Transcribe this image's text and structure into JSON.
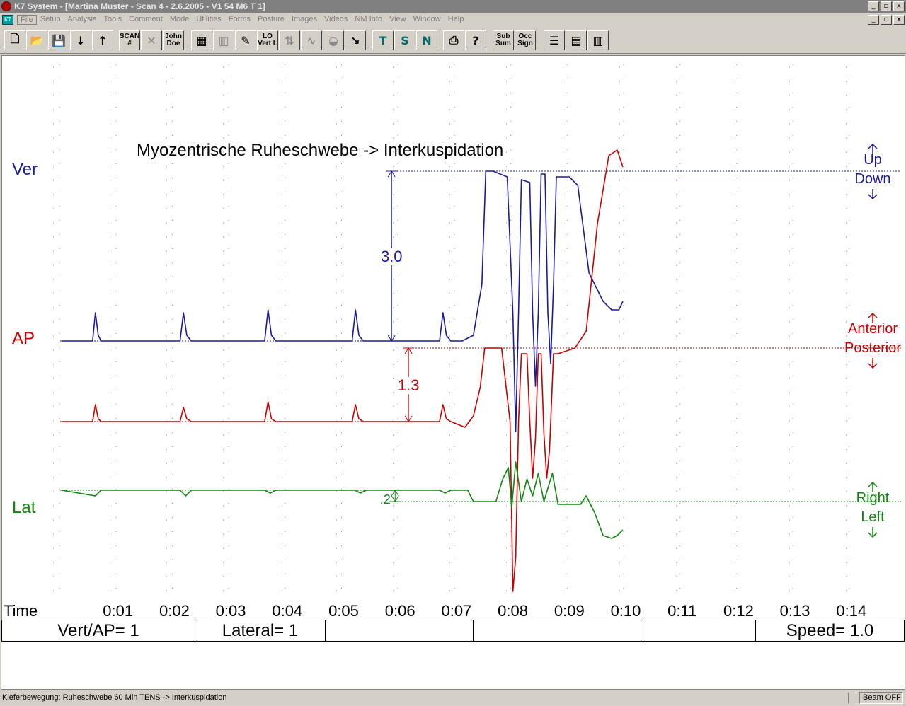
{
  "window": {
    "title": "K7 System - [Martina Muster - Scan 4 - 2.6.2005 - V1 54   M6  T 1]",
    "controls": [
      "_",
      "▫",
      "x"
    ],
    "doc_controls": [
      "_",
      "▫",
      "x"
    ]
  },
  "menu": {
    "doc_icon": "K7",
    "items": [
      "File",
      "Setup",
      "Analysis",
      "Tools",
      "Comment",
      "Mode",
      "Utilities",
      "Forms",
      "Posture",
      "Images",
      "Videos",
      "NM Info",
      "View",
      "Window",
      "Help"
    ]
  },
  "toolbar": {
    "groups": [
      [
        {
          "icon": "new-file-icon",
          "glyph": "🗋",
          "style": "normal"
        },
        {
          "icon": "open-folder-icon",
          "glyph": "📂",
          "style": "normal"
        },
        {
          "icon": "save-icon",
          "glyph": "💾",
          "style": "grey"
        },
        {
          "icon": "arrow-down-icon",
          "glyph": "↓",
          "style": "normal"
        },
        {
          "icon": "arrow-up-icon",
          "glyph": "↑",
          "style": "normal"
        }
      ],
      [
        {
          "icon": "scan-number-icon",
          "text": [
            "SCAN",
            "#"
          ],
          "style": "normal"
        },
        {
          "icon": "tools-icon",
          "glyph": "✕",
          "style": "grey"
        },
        {
          "icon": "john-doe-icon",
          "text": [
            "John",
            "Doe"
          ],
          "style": "normal"
        }
      ],
      [
        {
          "icon": "sweep-icon",
          "glyph": "▦",
          "style": "normal"
        },
        {
          "icon": "bars-icon",
          "glyph": "▥",
          "style": "grey"
        },
        {
          "icon": "pencil-icon",
          "glyph": "✎",
          "style": "normal"
        },
        {
          "icon": "vert-lat-icon",
          "text": [
            "LO",
            "Vert L"
          ],
          "style": "normal"
        },
        {
          "icon": "lat-icon",
          "glyph": "⇅",
          "style": "grey"
        },
        {
          "icon": "wave-icon",
          "glyph": "∿",
          "style": "grey"
        },
        {
          "icon": "head-icon",
          "glyph": "◒",
          "style": "grey"
        },
        {
          "icon": "cursor-icon",
          "glyph": "↘",
          "style": "normal"
        }
      ],
      [
        {
          "icon": "template-t-icon",
          "glyph": "T",
          "style": "teal"
        },
        {
          "icon": "template-s-icon",
          "glyph": "S",
          "style": "teal"
        },
        {
          "icon": "template-n-icon",
          "glyph": "N",
          "style": "teal"
        }
      ],
      [
        {
          "icon": "printer-icon",
          "glyph": "⎙",
          "style": "normal"
        },
        {
          "icon": "help-icon",
          "glyph": "?",
          "style": "normal"
        }
      ],
      [
        {
          "icon": "sub-sum-icon",
          "text": [
            "Sub",
            "Sum"
          ],
          "style": "normal"
        },
        {
          "icon": "occ-sign-icon",
          "text": [
            "Occ",
            "Sign"
          ],
          "style": "normal"
        }
      ],
      [
        {
          "icon": "layout-stack-icon",
          "glyph": "☰",
          "style": "normal"
        },
        {
          "icon": "layout-rows-icon",
          "glyph": "▤",
          "style": "normal"
        },
        {
          "icon": "layout-cols-icon",
          "glyph": "▥",
          "style": "normal"
        }
      ]
    ]
  },
  "chart_data": {
    "type": "line",
    "title": "Myozentrische Ruheschwebe -> Interkuspidation",
    "xlabel": "Time",
    "x_ticks": [
      "0:01",
      "0:02",
      "0:03",
      "0:04",
      "0:05",
      "0:06",
      "0:07",
      "0:08",
      "0:09",
      "0:10",
      "0:11",
      "0:12",
      "0:13",
      "0:14"
    ],
    "xlim": [
      0,
      14.5
    ],
    "grid": "dotted",
    "colors": {
      "ver": "#1a1aa0",
      "ap": "#cc0000",
      "lat": "#118811"
    },
    "series": [
      {
        "name": "Ver",
        "key": "ver",
        "unit_note": "trace value, 0 = baseline, positive = up",
        "points": [
          [
            0,
            0
          ],
          [
            0.55,
            0
          ],
          [
            0.6,
            0.5
          ],
          [
            0.65,
            0.1
          ],
          [
            0.7,
            0
          ],
          [
            1.1,
            0
          ],
          [
            2.1,
            0
          ],
          [
            2.16,
            0.5
          ],
          [
            2.22,
            0.1
          ],
          [
            2.3,
            0
          ],
          [
            3.6,
            0
          ],
          [
            3.66,
            0.55
          ],
          [
            3.72,
            0.1
          ],
          [
            3.8,
            0
          ],
          [
            5.15,
            0
          ],
          [
            5.21,
            0.55
          ],
          [
            5.27,
            0.1
          ],
          [
            5.35,
            0
          ],
          [
            6.7,
            0
          ],
          [
            6.76,
            0.5
          ],
          [
            6.82,
            0.1
          ],
          [
            6.9,
            0
          ],
          [
            7.1,
            0
          ],
          [
            7.3,
            0.1
          ],
          [
            7.45,
            1.0
          ],
          [
            7.52,
            3.0
          ],
          [
            7.65,
            3.0
          ],
          [
            7.9,
            2.9
          ],
          [
            8.0,
            0.5
          ],
          [
            8.05,
            -1.6
          ],
          [
            8.1,
            0.5
          ],
          [
            8.15,
            2.85
          ],
          [
            8.3,
            2.8
          ],
          [
            8.35,
            0.5
          ],
          [
            8.4,
            -0.8
          ],
          [
            8.45,
            0.5
          ],
          [
            8.5,
            2.95
          ],
          [
            8.57,
            2.95
          ],
          [
            8.62,
            0.5
          ],
          [
            8.67,
            -0.4
          ],
          [
            8.72,
            1.0
          ],
          [
            8.77,
            2.9
          ],
          [
            9.0,
            2.9
          ],
          [
            9.15,
            2.75
          ],
          [
            9.35,
            1.2
          ],
          [
            9.6,
            0.7
          ],
          [
            9.75,
            0.55
          ],
          [
            9.88,
            0.55
          ],
          [
            9.95,
            0.7
          ]
        ]
      },
      {
        "name": "AP",
        "key": "ap",
        "unit_note": "trace value, 0 = baseline, positive = anterior",
        "points": [
          [
            0,
            0
          ],
          [
            0.55,
            0
          ],
          [
            0.6,
            0.3
          ],
          [
            0.65,
            0.05
          ],
          [
            0.7,
            0
          ],
          [
            2.1,
            0
          ],
          [
            2.16,
            0.25
          ],
          [
            2.22,
            0.05
          ],
          [
            2.3,
            0
          ],
          [
            3.6,
            0
          ],
          [
            3.66,
            0.35
          ],
          [
            3.72,
            0.05
          ],
          [
            3.8,
            0
          ],
          [
            5.15,
            0
          ],
          [
            5.21,
            0.3
          ],
          [
            5.27,
            0.05
          ],
          [
            5.35,
            0
          ],
          [
            6.7,
            0
          ],
          [
            6.76,
            0.3
          ],
          [
            6.82,
            0.05
          ],
          [
            6.9,
            0
          ],
          [
            7.15,
            -0.1
          ],
          [
            7.3,
            0.1
          ],
          [
            7.42,
            0.6
          ],
          [
            7.5,
            1.3
          ],
          [
            7.8,
            1.3
          ],
          [
            7.95,
            0
          ],
          [
            8.0,
            -3.0
          ],
          [
            8.05,
            -2.4
          ],
          [
            8.1,
            0
          ],
          [
            8.15,
            1.2
          ],
          [
            8.25,
            1.2
          ],
          [
            8.3,
            0
          ],
          [
            8.35,
            -1.0
          ],
          [
            8.4,
            -0.3
          ],
          [
            8.45,
            1.2
          ],
          [
            8.5,
            1.2
          ],
          [
            8.55,
            -0.2
          ],
          [
            8.6,
            -1.0
          ],
          [
            8.65,
            -0.5
          ],
          [
            8.72,
            1.2
          ],
          [
            8.8,
            1.2
          ],
          [
            9.1,
            1.3
          ],
          [
            9.3,
            1.6
          ],
          [
            9.5,
            3.5
          ],
          [
            9.7,
            4.7
          ],
          [
            9.85,
            4.8
          ],
          [
            9.95,
            4.5
          ]
        ]
      },
      {
        "name": "Lat",
        "key": "lat",
        "unit_note": "trace value, 0 = baseline, positive = right",
        "points": [
          [
            0,
            0
          ],
          [
            0.6,
            -0.1
          ],
          [
            0.7,
            0
          ],
          [
            2.1,
            0
          ],
          [
            2.2,
            -0.1
          ],
          [
            2.3,
            0
          ],
          [
            3.6,
            0
          ],
          [
            3.7,
            -0.05
          ],
          [
            3.8,
            0
          ],
          [
            5.2,
            0
          ],
          [
            5.3,
            -0.05
          ],
          [
            5.4,
            0
          ],
          [
            6.7,
            0
          ],
          [
            6.8,
            -0.05
          ],
          [
            6.9,
            0
          ],
          [
            7.2,
            0
          ],
          [
            7.3,
            -0.2
          ],
          [
            7.5,
            -0.2
          ],
          [
            7.7,
            -0.2
          ],
          [
            7.82,
            0.2
          ],
          [
            7.92,
            0.4
          ],
          [
            7.98,
            -0.3
          ],
          [
            8.05,
            0.5
          ],
          [
            8.15,
            -0.2
          ],
          [
            8.25,
            0.2
          ],
          [
            8.35,
            -0.1
          ],
          [
            8.45,
            0.3
          ],
          [
            8.55,
            -0.2
          ],
          [
            8.7,
            0.3
          ],
          [
            8.8,
            -0.25
          ],
          [
            9.2,
            -0.25
          ],
          [
            9.3,
            -0.1
          ],
          [
            9.45,
            -0.4
          ],
          [
            9.6,
            -0.8
          ],
          [
            9.75,
            -0.85
          ],
          [
            9.85,
            -0.8
          ],
          [
            9.95,
            -0.7
          ]
        ]
      }
    ],
    "labels": {
      "ver": "Ver",
      "ap": "AP",
      "lat": "Lat"
    },
    "measurements": [
      {
        "label": "3.0",
        "series": "ver",
        "from": 0,
        "to": 3.0,
        "x": 5.85
      },
      {
        "label": "1.3",
        "series": "ap",
        "from": 0,
        "to": 1.3,
        "x": 6.15
      },
      {
        "label": ".2",
        "series": "lat",
        "from": 0,
        "to": -0.2,
        "x": 5.9
      }
    ],
    "direction_labels": {
      "ver": [
        "Up",
        "Down"
      ],
      "ap": [
        "Anterior",
        "Posterior"
      ],
      "lat": [
        "Right",
        "Left"
      ]
    }
  },
  "info": {
    "vert_ap": "Vert/AP= 1",
    "lateral": "Lateral= 1",
    "speed": "Speed= 1.0"
  },
  "status": {
    "text": "Kieferbewegung: Ruheschwebe 60 Min TENS -> Interkuspidation",
    "beam": "Beam OFF"
  }
}
